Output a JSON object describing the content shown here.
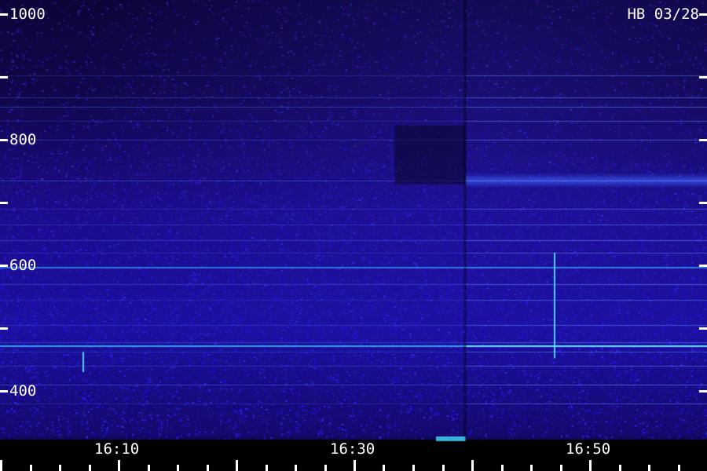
{
  "chart_data": {
    "type": "heatmap",
    "title": "",
    "stamp": "HB 03/28",
    "y_axis": {
      "range": [
        350,
        1000
      ],
      "tick_labels": [
        {
          "value": 1000,
          "label": "1000"
        },
        {
          "value": 800,
          "label": "800"
        },
        {
          "value": 600,
          "label": "600"
        },
        {
          "value": 400,
          "label": "400"
        }
      ],
      "tick_values": [
        1000,
        900,
        800,
        700,
        600,
        500,
        400
      ]
    },
    "x_axis": {
      "range_minutes": [
        0,
        60
      ],
      "tick_labels": [
        {
          "minute": 20,
          "label": "16:10"
        },
        {
          "minute": 40,
          "label": "16:30"
        },
        {
          "minute": 20,
          "label": "16:50",
          "_slot": 3
        }
      ]
    },
    "features": {
      "horizontal_lines_freq": [
        903,
        867,
        852,
        830,
        800,
        735,
        690,
        665,
        640,
        620,
        598,
        570,
        545,
        505,
        478,
        462,
        440,
        410,
        380
      ],
      "strong_line_freq": 472,
      "segment_break_minute": 39.5,
      "vertical_spikes": [
        {
          "minute": 47,
          "freq_low": 452,
          "freq_high": 620
        },
        {
          "minute": 7,
          "freq_low": 430,
          "freq_high": 462
        }
      ]
    },
    "grid": false,
    "colormap": [
      "#000000",
      "#12095a",
      "#2412c8",
      "#3a6bff",
      "#3fd6ff"
    ]
  }
}
